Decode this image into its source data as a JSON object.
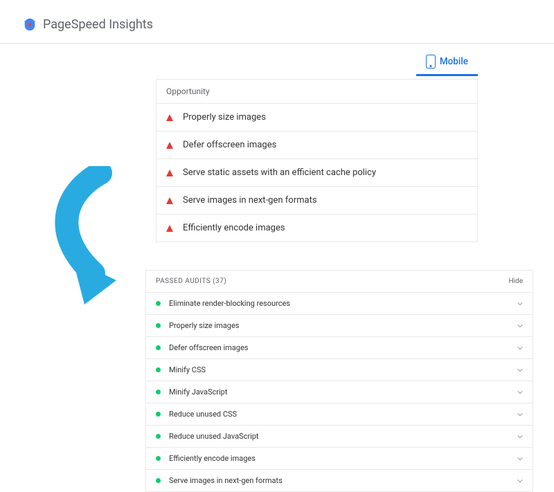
{
  "header": {
    "title": "PageSpeed Insights"
  },
  "tabs": {
    "mobile": "Mobile"
  },
  "opportunity": {
    "heading": "Opportunity",
    "items": [
      {
        "label": "Properly size images"
      },
      {
        "label": "Defer offscreen images"
      },
      {
        "label": "Serve static assets with an efficient cache policy"
      },
      {
        "label": "Serve images in next-gen formats"
      },
      {
        "label": "Efficiently encode images"
      }
    ]
  },
  "passed": {
    "heading": "PASSED AUDITS (37)",
    "hide_label": "Hide",
    "items": [
      {
        "label": "Eliminate render-blocking resources"
      },
      {
        "label": "Properly size images"
      },
      {
        "label": "Defer offscreen images"
      },
      {
        "label": "Minify CSS"
      },
      {
        "label": "Minify JavaScript"
      },
      {
        "label": "Reduce unused CSS"
      },
      {
        "label": "Reduce unused JavaScript"
      },
      {
        "label": "Efficiently encode images"
      },
      {
        "label": "Serve images in next-gen formats"
      }
    ]
  }
}
